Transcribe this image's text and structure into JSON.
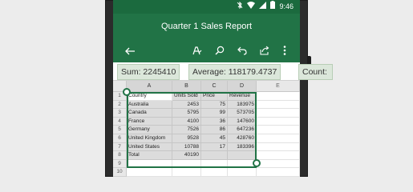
{
  "status_bar": {
    "time": "9:46",
    "icons": [
      "bluetooth-off-icon",
      "wifi-icon",
      "signal-icon",
      "battery-icon"
    ]
  },
  "title": "Quarter 1 Sales Report",
  "toolbar": {
    "icons": [
      "back-arrow-icon",
      "format-pen-icon",
      "search-icon",
      "undo-icon",
      "share-icon",
      "more-vert-icon"
    ]
  },
  "stats": {
    "sum": "Sum: 2245410",
    "average": "Average: 118179.4737",
    "count": "Count:"
  },
  "sheet": {
    "columns": [
      "A",
      "B",
      "C",
      "D",
      "E"
    ],
    "rows": [
      "1",
      "2",
      "3",
      "4",
      "5",
      "6",
      "7",
      "8",
      "9",
      "10"
    ],
    "headers": [
      "Country",
      "Units Sold",
      "Price",
      "Revenue"
    ],
    "data": [
      [
        "Australia",
        "2453",
        "75",
        "183975"
      ],
      [
        "Canada",
        "5795",
        "99",
        "573705"
      ],
      [
        "France",
        "4100",
        "36",
        "147600"
      ],
      [
        "Germany",
        "7526",
        "86",
        "647236"
      ],
      [
        "United Kingdom",
        "9528",
        "45",
        "428760"
      ],
      [
        "United States",
        "10788",
        "17",
        "183396"
      ],
      [
        "Total",
        "40190",
        "",
        ""
      ]
    ]
  },
  "colors": {
    "excel_green": "#217346",
    "status_green": "#1b6a3e",
    "selection_fill": "#dcdcdc"
  }
}
